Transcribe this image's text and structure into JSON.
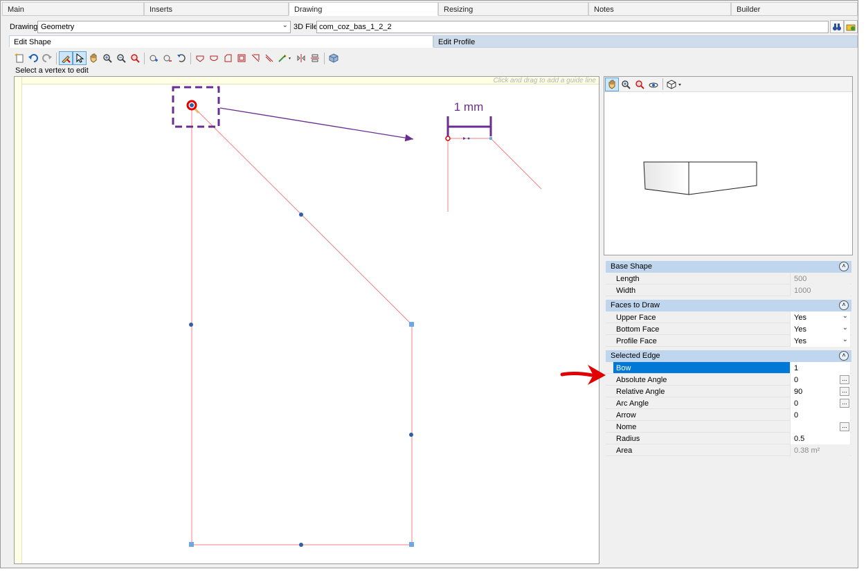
{
  "top_tabs": [
    "Main",
    "Inserts",
    "Drawing",
    "Resizing",
    "Notes",
    "Builder"
  ],
  "drawing_row": {
    "drawing_label": "Drawing",
    "drawing_value": "Geometry",
    "file_label": "3D File",
    "file_value": "com_coz_bas_1_2_2"
  },
  "sub_tabs": [
    "Edit Shape",
    "Edit Profile"
  ],
  "status_text": "Select a vertex to edit",
  "canvas": {
    "guide_hint": "Click and drag to add a guide line",
    "annotation_label": "1 mm"
  },
  "properties": {
    "base_shape": {
      "title": "Base Shape",
      "rows": [
        {
          "name": "Length",
          "value": "500"
        },
        {
          "name": "Width",
          "value": "1000"
        }
      ]
    },
    "faces": {
      "title": "Faces to Draw",
      "rows": [
        {
          "name": "Upper Face",
          "value": "Yes"
        },
        {
          "name": "Bottom Face",
          "value": "Yes"
        },
        {
          "name": "Profile Face",
          "value": "Yes"
        }
      ]
    },
    "edge": {
      "title": "Selected Edge",
      "rows": [
        {
          "name": "Bow",
          "value": "1"
        },
        {
          "name": "Absolute Angle",
          "value": "0"
        },
        {
          "name": "Relative Angle",
          "value": "90"
        },
        {
          "name": "Arc Angle",
          "value": "0"
        },
        {
          "name": "Arrow",
          "value": "0"
        },
        {
          "name": "Nome",
          "value": ""
        },
        {
          "name": "Radius",
          "value": "0.5"
        },
        {
          "name": "Area",
          "value": "0.38 m²"
        }
      ]
    }
  },
  "colors": {
    "accent": "#0078d7",
    "section_header": "#bfd6ee",
    "shape_line": "#f08080",
    "annotation_purple": "#6a2c91",
    "annotation_red": "#e00000"
  }
}
